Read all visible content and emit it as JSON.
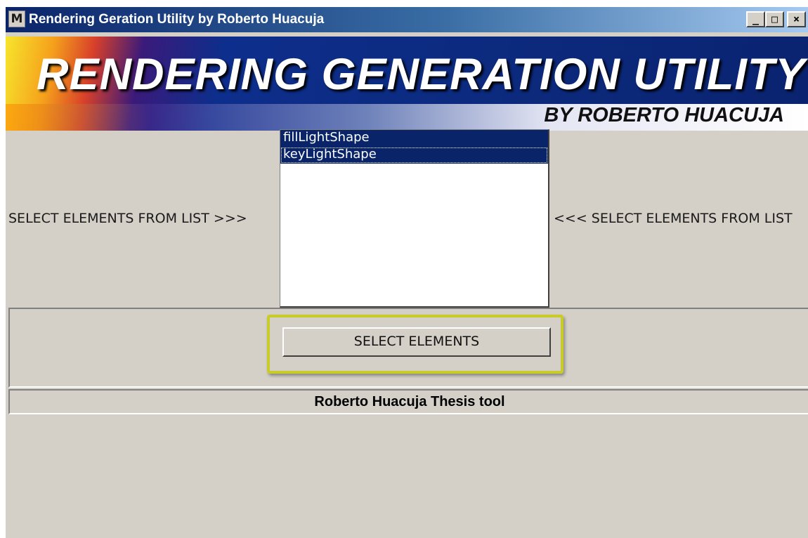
{
  "window": {
    "title": "Rendering Geration Utility by Roberto Huacuja",
    "icon_glyph": "M",
    "controls": {
      "minimize": "_",
      "maximize": "□",
      "close": "×"
    }
  },
  "banner": {
    "title": "RENDERING GENERATION UTILITY",
    "subtitle": "BY ROBERTO HUACUJA"
  },
  "selection": {
    "left_label": "SELECT ELEMENTS FROM LIST >>>",
    "right_label": "<<< SELECT ELEMENTS FROM LIST",
    "items": [
      "fillLightShape",
      "keyLightShape"
    ]
  },
  "actions": {
    "select_label": "SELECT ELEMENTS"
  },
  "status": {
    "text": "Roberto Huacuja Thesis tool"
  },
  "colors": {
    "selection_bg": "#0a246a",
    "window_face": "#d4d0c8",
    "highlight_frame": "#c9cc26"
  },
  "icons": [
    "app-icon",
    "minimize-icon",
    "maximize-icon",
    "close-icon"
  ]
}
